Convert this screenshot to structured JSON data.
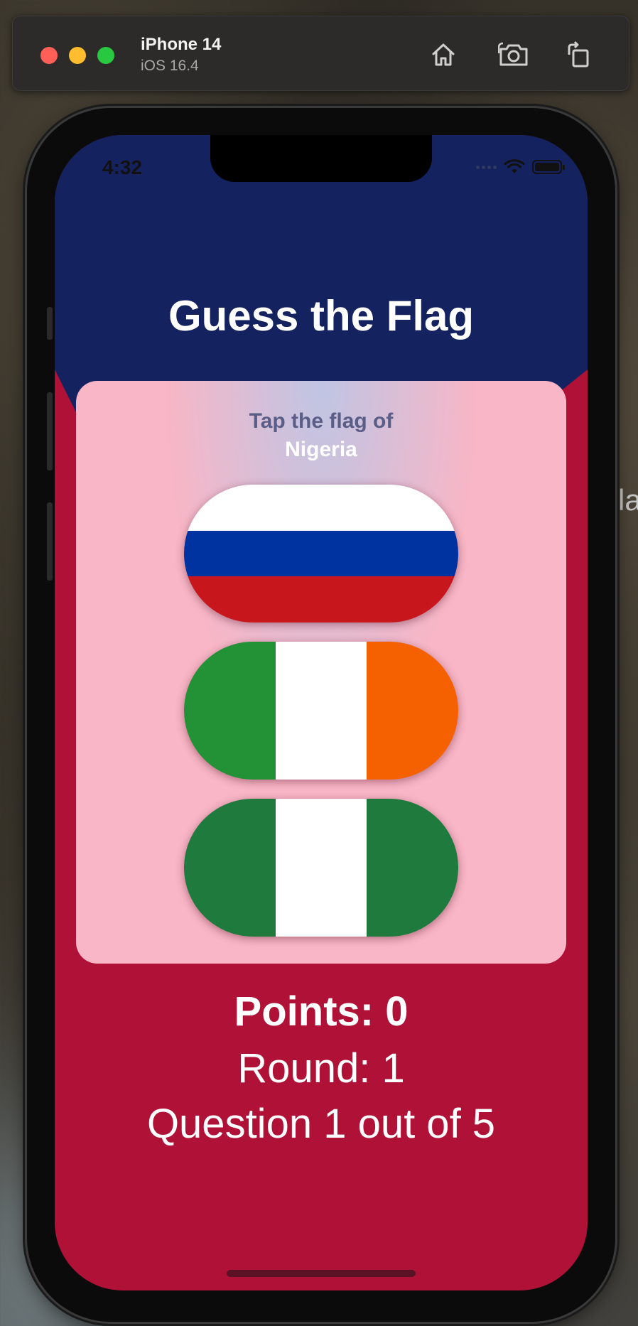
{
  "simulator": {
    "device_name": "iPhone 14",
    "os_version": "iOS 16.4",
    "buttons": {
      "home": "home-icon",
      "screenshot": "camera-icon",
      "rotate": "rotate-icon"
    }
  },
  "status_bar": {
    "time": "4:32"
  },
  "app": {
    "title": "Guess the Flag",
    "prompt_subtitle": "Tap the flag of",
    "prompt_country": "Nigeria",
    "flags": [
      {
        "name": "Russia",
        "orientation": "horizontal",
        "colors": [
          "#ffffff",
          "#0033a0",
          "#c8161d"
        ]
      },
      {
        "name": "Ireland",
        "orientation": "vertical",
        "colors": [
          "#239136",
          "#ffffff",
          "#f56000"
        ]
      },
      {
        "name": "Nigeria",
        "orientation": "vertical",
        "colors": [
          "#1f7a3e",
          "#ffffff",
          "#1f7a3e"
        ]
      }
    ],
    "points_text": "Points: 0",
    "round_text": "Round: 1",
    "question_text": "Question 1 out of 5"
  },
  "colors": {
    "header_navy": "#152260",
    "background_red": "#af1236",
    "card_pink": "#f8b6c6"
  },
  "background_peek_text": "la"
}
